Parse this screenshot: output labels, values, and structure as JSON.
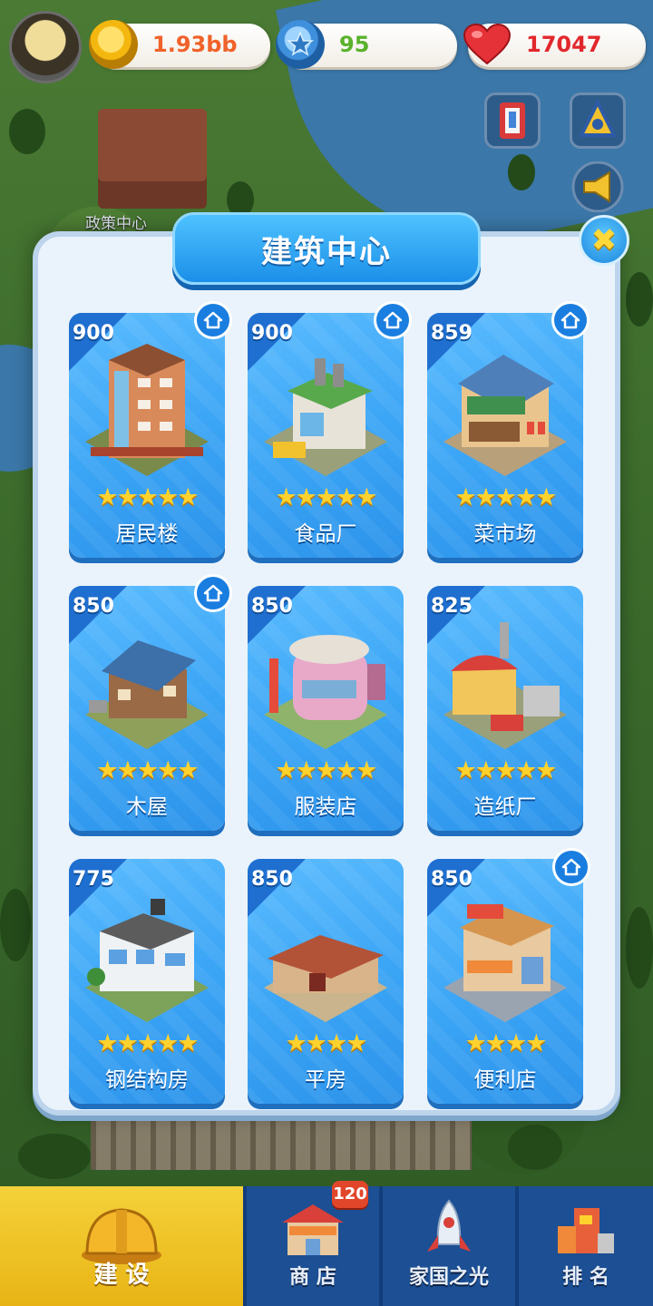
{
  "hud": {
    "gold": "1.93bb",
    "gems": "95",
    "hearts": "17047"
  },
  "scene": {
    "building_label": "政策中心"
  },
  "panel": {
    "title": "建筑中心",
    "close_symbol": "✖"
  },
  "cards": [
    {
      "price": "900",
      "name": "居民楼",
      "stars": "★★★★★",
      "owned": true
    },
    {
      "price": "900",
      "name": "食品厂",
      "stars": "★★★★★",
      "owned": true
    },
    {
      "price": "859",
      "name": "菜市场",
      "stars": "★★★★★",
      "owned": true
    },
    {
      "price": "850",
      "name": "木屋",
      "stars": "★★★★★",
      "owned": true
    },
    {
      "price": "850",
      "name": "服装店",
      "stars": "★★★★★",
      "owned": false
    },
    {
      "price": "825",
      "name": "造纸厂",
      "stars": "★★★★★",
      "owned": false
    },
    {
      "price": "775",
      "name": "钢结构房",
      "stars": "★★★★★",
      "owned": false
    },
    {
      "price": "850",
      "name": "平房",
      "stars": "★★★★",
      "owned": false
    },
    {
      "price": "850",
      "name": "便利店",
      "stars": "★★★★",
      "owned": true
    }
  ],
  "nav": {
    "build": "建 设",
    "shop": "商 店",
    "shop_badge": "120",
    "home": "家国之光",
    "rank": "排 名"
  },
  "colors": {
    "card_blue": "#3aa4f5",
    "banner_blue": "#1b8fe8",
    "star_yellow": "#ffd22e",
    "nav_dark": "#123d7a",
    "build_tab": "#e8b415"
  }
}
